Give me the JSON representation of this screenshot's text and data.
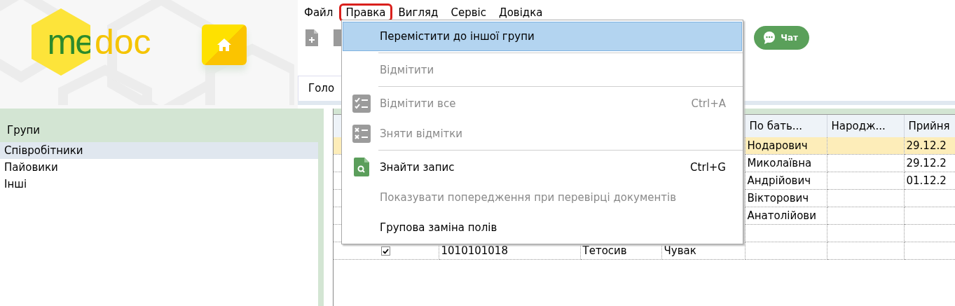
{
  "logo": {
    "part_1": "me",
    "part_2": "doc"
  },
  "menubar": [
    {
      "label": "Файл",
      "selected": false
    },
    {
      "label": "Правка",
      "selected": true
    },
    {
      "label": "Вигляд",
      "selected": false
    },
    {
      "label": "Сервіс",
      "selected": false
    },
    {
      "label": "Довідка",
      "selected": false
    }
  ],
  "chat_button": {
    "label": "Чат"
  },
  "tabs": [
    {
      "label": "Голо"
    }
  ],
  "groups": {
    "title": "Групи",
    "items": [
      {
        "label": "Співробітники",
        "selected": true
      },
      {
        "label": "Пайовики",
        "selected": false
      },
      {
        "label": "Інші",
        "selected": false
      }
    ]
  },
  "table": {
    "header": {
      "patronymic": "По бать...",
      "birth": "Народж...",
      "hired": "Прийня"
    },
    "rows": [
      {
        "selected": true,
        "patronymic": "Нодарович",
        "hired": "29.12.2"
      },
      {
        "selected": false,
        "patronymic": "Миколаївна",
        "hired": "29.12.2"
      },
      {
        "selected": false,
        "patronymic": "Андрійович",
        "hired": "01.12.2"
      },
      {
        "selected": false,
        "patronymic": "Вікторович"
      },
      {
        "selected": false,
        "patronymic": "Анатолійови"
      },
      {
        "selected": false
      },
      {
        "selected": false,
        "checked": true,
        "code": "1010101018",
        "surname": "Тетосив",
        "name": "Чувак"
      }
    ]
  },
  "edit_menu": [
    {
      "kind": "item",
      "label": "Перемістити до іншої групи",
      "selected": true,
      "disabled": false
    },
    {
      "kind": "separator"
    },
    {
      "kind": "item",
      "label": "Відмітити",
      "selected": false,
      "disabled": true
    },
    {
      "kind": "separator"
    },
    {
      "kind": "item",
      "label": "Відмітити все",
      "shortcut": "Ctrl+A",
      "selected": false,
      "disabled": true
    },
    {
      "kind": "item",
      "label": "Зняти відмітки",
      "selected": false,
      "disabled": true
    },
    {
      "kind": "separator"
    },
    {
      "kind": "item",
      "label": "Знайти запис",
      "shortcut": "Ctrl+G",
      "selected": false,
      "disabled": false
    },
    {
      "kind": "item",
      "label": "Показувати попередження при перевірці документів",
      "selected": false,
      "disabled": true
    },
    {
      "kind": "item",
      "label": "Групова заміна полів",
      "selected": false,
      "disabled": false
    }
  ]
}
